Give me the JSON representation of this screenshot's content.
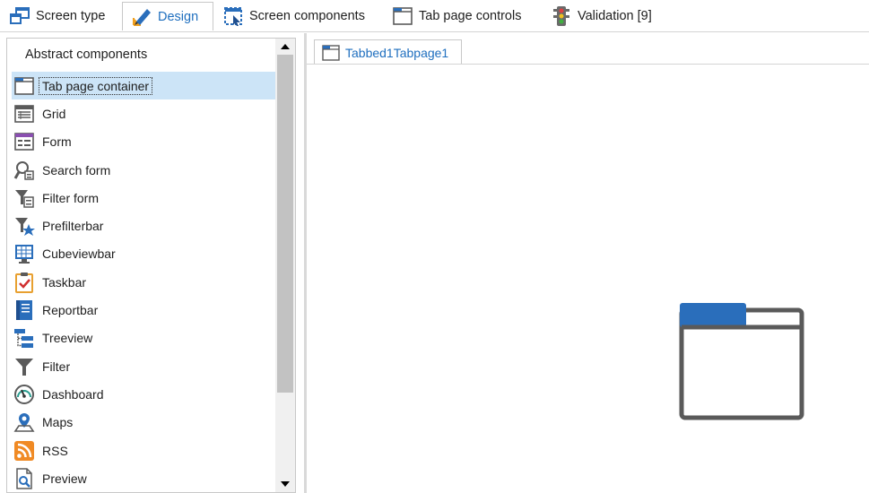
{
  "tabs": [
    {
      "label": "Screen type",
      "icon": "screen-type-icon"
    },
    {
      "label": "Design",
      "icon": "design-pen-icon",
      "active": true
    },
    {
      "label": "Screen components",
      "icon": "screen-components-icon"
    },
    {
      "label": "Tab page controls",
      "icon": "tab-page-icon"
    },
    {
      "label": "Validation [9]",
      "icon": "traffic-light-icon"
    }
  ],
  "panel": {
    "title": "Abstract components",
    "items": [
      {
        "label": "Tab page container",
        "icon": "tab-page-container-icon",
        "selected": true
      },
      {
        "label": "Grid",
        "icon": "grid-icon"
      },
      {
        "label": "Form",
        "icon": "form-icon"
      },
      {
        "label": "Search form",
        "icon": "search-form-icon"
      },
      {
        "label": "Filter form",
        "icon": "filter-form-icon"
      },
      {
        "label": "Prefilterbar",
        "icon": "prefilterbar-icon"
      },
      {
        "label": "Cubeviewbar",
        "icon": "cubeviewbar-icon"
      },
      {
        "label": "Taskbar",
        "icon": "taskbar-icon"
      },
      {
        "label": "Reportbar",
        "icon": "reportbar-icon"
      },
      {
        "label": "Treeview",
        "icon": "treeview-icon"
      },
      {
        "label": "Filter",
        "icon": "filter-icon"
      },
      {
        "label": "Dashboard",
        "icon": "dashboard-icon"
      },
      {
        "label": "Maps",
        "icon": "maps-icon"
      },
      {
        "label": "RSS",
        "icon": "rss-icon"
      },
      {
        "label": "Preview",
        "icon": "preview-icon"
      }
    ]
  },
  "canvas": {
    "tab_label": "Tabbed1Tabpage1",
    "placeholder_icon": "tab-page-container-icon"
  },
  "colors": {
    "accent": "#1f6fbf",
    "selection": "#cce4f7",
    "icon_blue": "#2a6ebb",
    "icon_gray": "#5a5a5a"
  }
}
